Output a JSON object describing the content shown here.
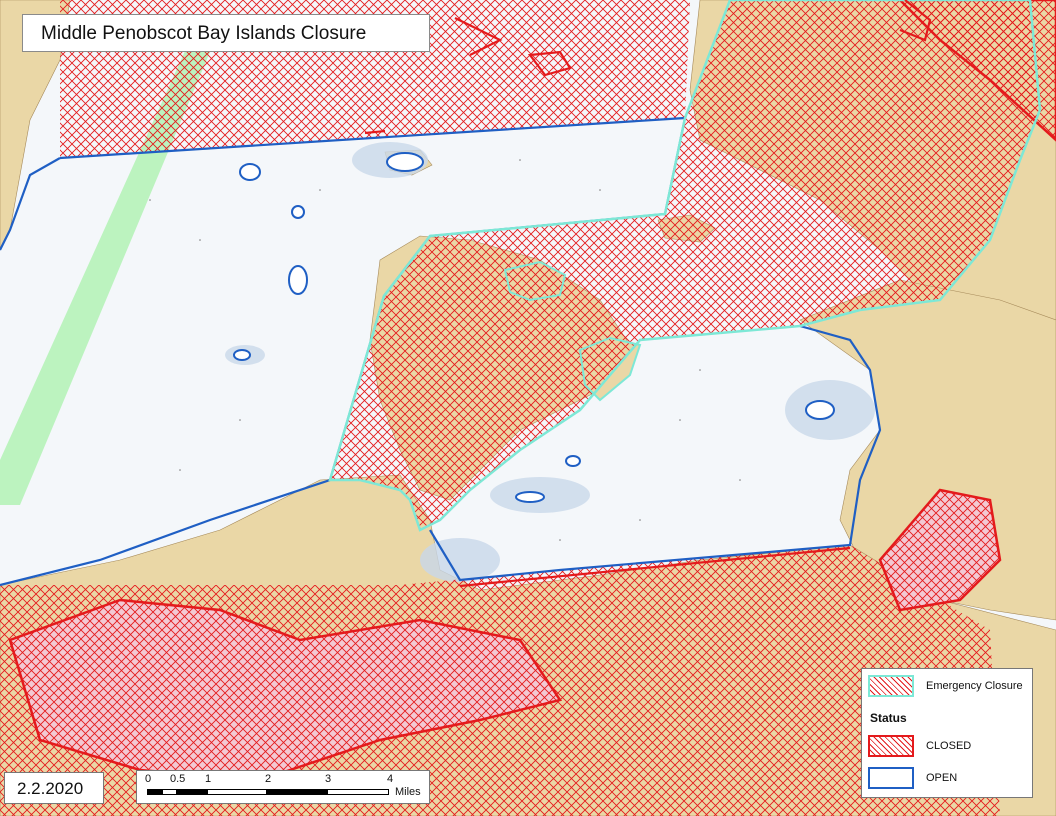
{
  "map": {
    "title": "Middle Penobscot Bay Islands Closure",
    "date": "2.2.2020",
    "colors": {
      "water": "#ffffff",
      "land": "#ead7a6",
      "shallow": "#c9d8ea",
      "closed": "#e41a1c",
      "open": "#1f5fc4",
      "emergency": "#7de8d6",
      "lane": "#8ef08e"
    }
  },
  "scale_bar": {
    "ticks": [
      "0",
      "0.5",
      "1",
      "2",
      "3",
      "4"
    ],
    "units": "Miles"
  },
  "legend": {
    "emergency_label": "Emergency Closure",
    "status_heading": "Status",
    "closed_label": "CLOSED",
    "open_label": "OPEN"
  }
}
